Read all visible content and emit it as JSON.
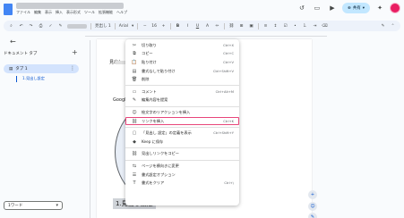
{
  "app": {
    "menubar": [
      "ファイル",
      "編集",
      "表示",
      "挿入",
      "表示形式",
      "ツール",
      "拡張機能",
      "ヘルプ"
    ],
    "share_label": "共有",
    "share_icon": "globe-icon"
  },
  "toolbar": {
    "style_dropdown": "見出し 1",
    "font": "Arial",
    "font_size": "16"
  },
  "left_panel": {
    "tabs_title": "ドキュメント タブ",
    "tab_label": "タブ 1",
    "outline_item": "1.見出し設定",
    "word_dropdown": "1ワード"
  },
  "document": {
    "heading_inline": "見出し",
    "google_text": "Google",
    "heading_bottom": "1.見出し設定"
  },
  "context_menu": {
    "items": [
      {
        "icon": "scissors-icon",
        "label": "切り取り",
        "shortcut": "Ctrl+X"
      },
      {
        "icon": "copy-icon",
        "label": "コピー",
        "shortcut": "Ctrl+C"
      },
      {
        "icon": "paste-icon",
        "label": "貼り付け",
        "shortcut": "Ctrl+V"
      },
      {
        "icon": "paste-plain-icon",
        "label": "書式なしで貼り付け",
        "shortcut": "Ctrl+Shift+V"
      },
      {
        "icon": "trash-icon",
        "label": "削除",
        "shortcut": ""
      },
      {
        "divider": true
      },
      {
        "icon": "comment-icon",
        "label": "コメント",
        "shortcut": "Ctrl+Alt+M"
      },
      {
        "icon": "suggest-icon",
        "label": "編集内容を提案",
        "shortcut": ""
      },
      {
        "divider": true
      },
      {
        "icon": "emoji-icon",
        "label": "絵文字のリアクションを挿入",
        "shortcut": ""
      },
      {
        "icon": "link-icon",
        "label": "リンクを挿入",
        "shortcut": "Ctrl+K",
        "highlight": true
      },
      {
        "divider": true
      },
      {
        "icon": "heading-icon",
        "label": "「見出し 設定」の定義を表示",
        "shortcut": "Ctrl+Shift+Y"
      },
      {
        "icon": "keep-icon",
        "label": "Keep に保存",
        "shortcut": ""
      },
      {
        "divider": true
      },
      {
        "icon": "link-copy-icon",
        "label": "見出しリンクをコピー",
        "shortcut": ""
      },
      {
        "divider": true
      },
      {
        "icon": "orientation-icon",
        "label": "ページを横向きに変更",
        "shortcut": ""
      },
      {
        "icon": "format-options-icon",
        "label": "書式設定オプション",
        "shortcut": ""
      },
      {
        "icon": "clear-format-icon",
        "label": "書式をクリア",
        "shortcut": "Ctrl+\\"
      }
    ]
  }
}
